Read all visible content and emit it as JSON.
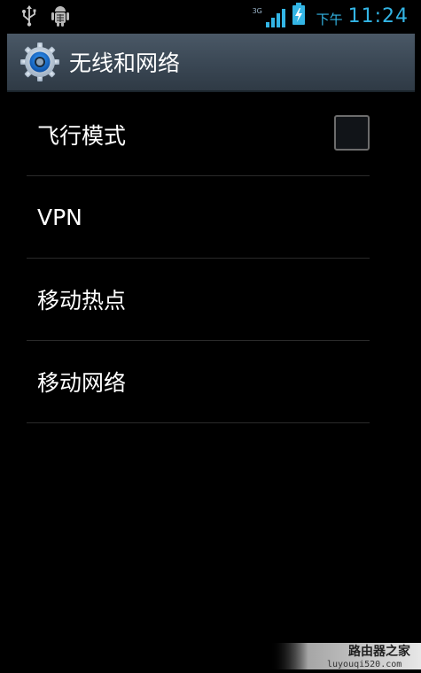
{
  "status_bar": {
    "network_type": "3G",
    "ampm": "下午",
    "time": "11:24",
    "left_icons": [
      "usb-icon",
      "android-debug-icon"
    ],
    "right_icons": [
      "signal-icon",
      "battery-charging-icon"
    ],
    "accent_color": "#33b5e5"
  },
  "title_bar": {
    "title": "无线和网络",
    "icon": "settings-gear-icon"
  },
  "list": {
    "items": [
      {
        "label": "飞行模式",
        "has_checkbox": true,
        "checked": false
      },
      {
        "label": "VPN"
      },
      {
        "label": "移动热点"
      },
      {
        "label": "移动网络"
      }
    ]
  },
  "watermark": {
    "text": "路由器之家",
    "url_text": "luyouqi520.com"
  }
}
